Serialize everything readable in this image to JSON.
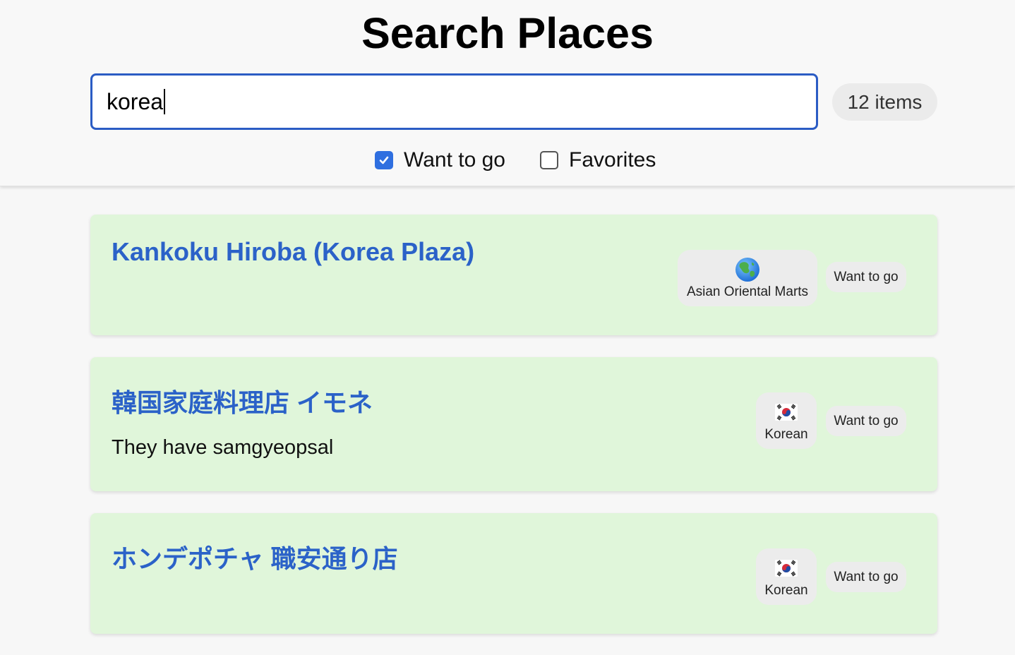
{
  "header": {
    "title": "Search Places",
    "search_value": "korea",
    "count_label": "12 items",
    "filters": [
      {
        "label": "Want to go",
        "checked": true
      },
      {
        "label": "Favorites",
        "checked": false
      }
    ]
  },
  "places": [
    {
      "name": "Kankoku Hiroba (Korea Plaza)",
      "note": "",
      "category": "Asian Oriental Marts",
      "category_icon": "globe-asia-icon",
      "status": "Want to go"
    },
    {
      "name": "韓国家庭料理店 イモネ",
      "note": "They have samgyeopsal",
      "category": "Korean",
      "category_icon": "korea-flag-icon",
      "status": "Want to go"
    },
    {
      "name": "ホンデポチャ 職安通り店",
      "note": "",
      "category": "Korean",
      "category_icon": "korea-flag-icon",
      "status": "Want to go"
    }
  ],
  "colors": {
    "accent": "#2b5cc4",
    "title_link": "#2b62c8",
    "card_background": "#e0f6da",
    "checkbox": "#2f6fe0"
  }
}
